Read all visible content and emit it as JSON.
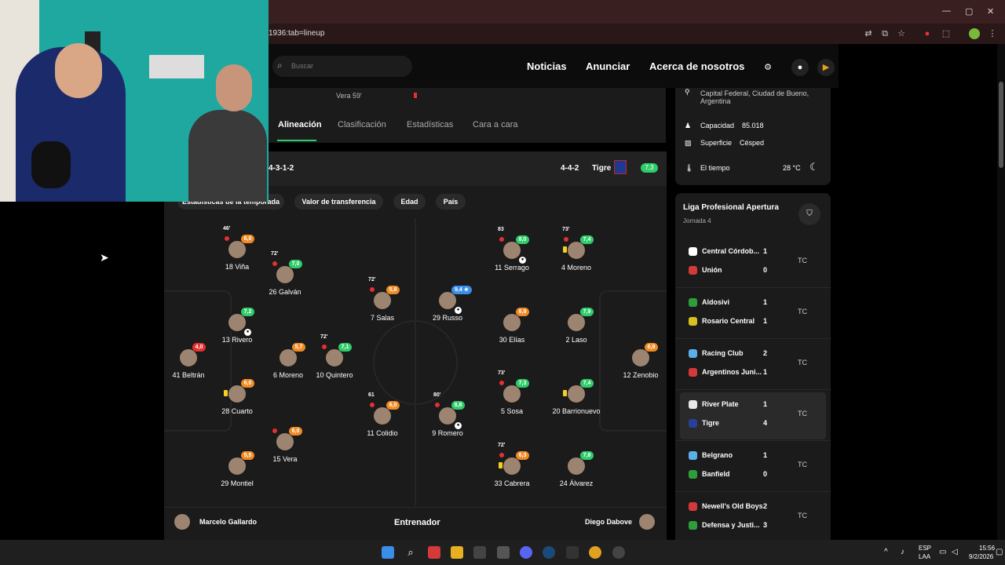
{
  "browser": {
    "url": "1936:tab=lineup",
    "window_controls": [
      "—",
      "▢",
      "✕"
    ]
  },
  "nav": {
    "search_placeholder": "Buscar",
    "links": [
      "Noticias",
      "Anunciar",
      "Acerca de nosotros"
    ]
  },
  "event": {
    "text": "Vera 59'"
  },
  "tabs": [
    "Alineación",
    "Clasificación",
    "Estadísticas",
    "Cara a cara"
  ],
  "lineup": {
    "left_formation": "4-3-1-2",
    "right_formation": "4-4-2",
    "right_team": "Tigre",
    "right_team_rating": "7,3",
    "chips": [
      "Estadísticas de la temporada",
      "Valor de transferencia",
      "Edad",
      "País"
    ],
    "players": [
      {
        "name": "18 Viña",
        "rating": "6,0",
        "sub": "46'"
      },
      {
        "name": "26 Galván",
        "rating": "7,0",
        "sub": "72'"
      },
      {
        "name": "7 Salas",
        "rating": "5,8",
        "sub": "72'"
      },
      {
        "name": "13 Rivero",
        "rating": "7,2"
      },
      {
        "name": "6 Moreno",
        "rating": "5,7"
      },
      {
        "name": "10 Quintero",
        "rating": "7,1",
        "sub": "72'"
      },
      {
        "name": "41 Beltrán",
        "rating": "4,0"
      },
      {
        "name": "28 Cuarto",
        "rating": "6,0"
      },
      {
        "name": "11 Colidio",
        "rating": "6,0",
        "sub": "61"
      },
      {
        "name": "15 Vera",
        "rating": "6,0"
      },
      {
        "name": "29 Montiel",
        "rating": "5,5"
      },
      {
        "name": "29 Russo",
        "rating": "9,4 ★"
      },
      {
        "name": "11 Serrago",
        "rating": "8,0",
        "sub": "83"
      },
      {
        "name": "4 Moreno",
        "rating": "7,4",
        "sub": "73'"
      },
      {
        "name": "30 Elías",
        "rating": "6,9"
      },
      {
        "name": "2 Laso",
        "rating": "7,9"
      },
      {
        "name": "12 Zenobio",
        "rating": "6,9"
      },
      {
        "name": "5 Sosa",
        "rating": "7,3",
        "sub": "73'"
      },
      {
        "name": "20 Barrionuevo",
        "rating": "7,4"
      },
      {
        "name": "9 Romero",
        "rating": "8,8",
        "sub": "80'"
      },
      {
        "name": "33 Cabrera",
        "rating": "6,3",
        "sub": "72'"
      },
      {
        "name": "24 Álvarez",
        "rating": "7,8"
      }
    ],
    "coach_label": "Entrenador",
    "coach_left": "Marcelo Gallardo",
    "coach_right": "Diego Dabove"
  },
  "stadium": {
    "location": "Capital Federal, Ciudad de Bueno, Argentina",
    "capacity_label": "Capacidad",
    "capacity": "85.018",
    "surface_label": "Superficie",
    "surface": "Césped",
    "weather_label": "El tiempo",
    "weather": "28 °C"
  },
  "league": {
    "name": "Liga Profesional Apertura",
    "round": "Jornada 4",
    "matches": [
      {
        "home": "Central Córdob...",
        "home_score": "1",
        "away": "Unión",
        "away_score": "0",
        "status": "TC",
        "home_color": "#ffffff",
        "away_color": "#d43a3a"
      },
      {
        "home": "Aldosivi",
        "home_score": "1",
        "away": "Rosario Central",
        "away_score": "1",
        "status": "TC",
        "home_color": "#2e9e3a",
        "away_color": "#d8c020"
      },
      {
        "home": "Racing Club",
        "home_score": "2",
        "away": "Argentinos Juni...",
        "away_score": "1",
        "status": "TC",
        "home_color": "#5ab0e8",
        "away_color": "#d43a3a"
      },
      {
        "home": "River Plate",
        "home_score": "1",
        "away": "Tigre",
        "away_score": "4",
        "status": "TC",
        "home_color": "#e8e8e8",
        "away_color": "#2a3f9a"
      },
      {
        "home": "Belgrano",
        "home_score": "1",
        "away": "Banfield",
        "away_score": "0",
        "status": "TC",
        "home_color": "#5ab0e8",
        "away_color": "#2e9e3a"
      },
      {
        "home": "Newell's Old Boys",
        "home_score": "2",
        "away": "Defensa y Justi...",
        "away_score": "3",
        "status": "TC",
        "home_color": "#d43a3a",
        "away_color": "#2e9e3a"
      }
    ]
  },
  "taskbar": {
    "lang": "ESP",
    "layout": "LAA",
    "time": "15:56",
    "date": "9/2/2026"
  }
}
